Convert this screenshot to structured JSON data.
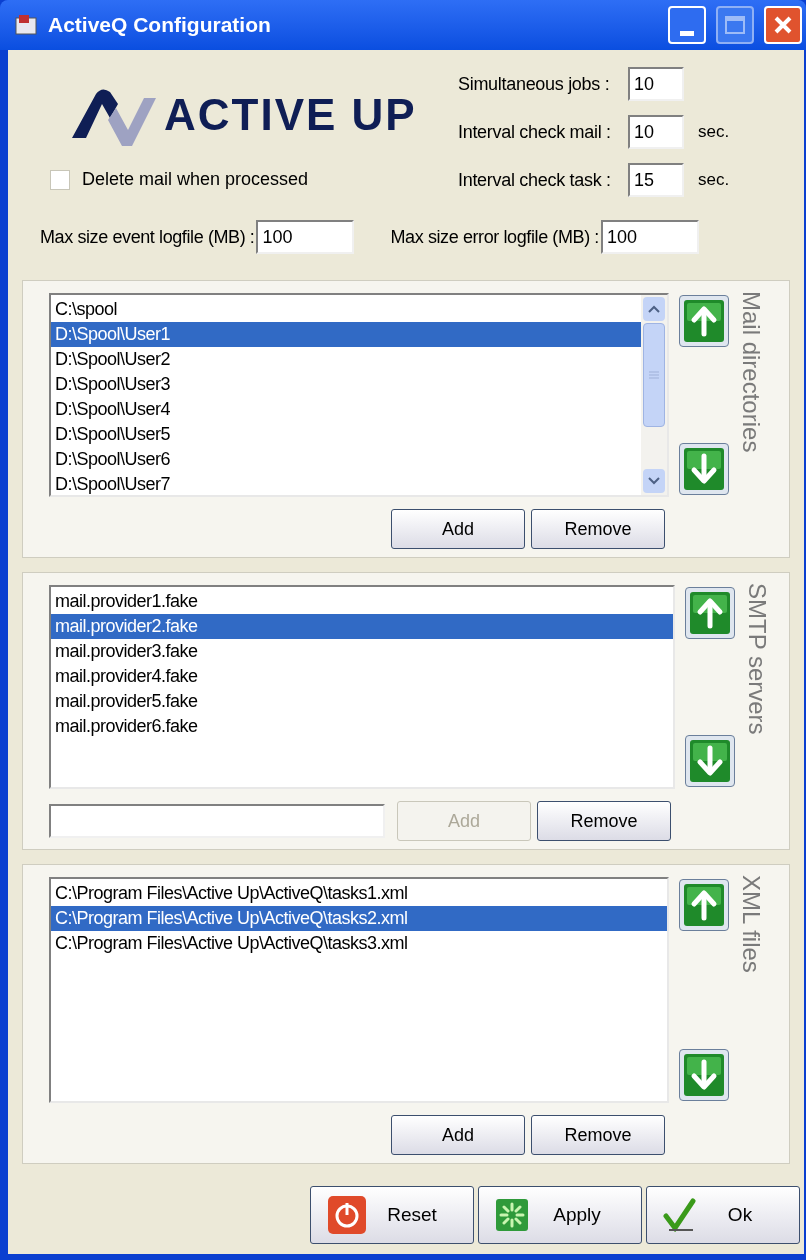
{
  "window": {
    "title": "ActiveQ Configuration"
  },
  "logo": {
    "text": "ACTIVE UP"
  },
  "settings": {
    "delete_mail": {
      "label": "Delete mail when processed",
      "checked": false
    },
    "fields": [
      {
        "label": "Simultaneous jobs :",
        "value": "10"
      },
      {
        "label": "Interval check mail :",
        "value": "10",
        "unit": "sec."
      },
      {
        "label": "Interval check task :",
        "value": "15",
        "unit": "sec."
      }
    ],
    "logfiles": [
      {
        "label": "Max size event logfile (MB) :",
        "value": "100"
      },
      {
        "label": "Max size error logfile (MB) :",
        "value": "100"
      }
    ]
  },
  "groups": [
    {
      "title": "Mail directories",
      "scrollbar": true,
      "input": false,
      "items": [
        {
          "label": "C:\\spool",
          "selected": false
        },
        {
          "label": "D:\\Spool\\User1",
          "selected": true
        },
        {
          "label": "D:\\Spool\\User2",
          "selected": false
        },
        {
          "label": "D:\\Spool\\User3",
          "selected": false
        },
        {
          "label": "D:\\Spool\\User4",
          "selected": false
        },
        {
          "label": "D:\\Spool\\User5",
          "selected": false
        },
        {
          "label": "D:\\Spool\\User6",
          "selected": false
        },
        {
          "label": "D:\\Spool\\User7",
          "selected": false
        }
      ],
      "buttons": [
        {
          "label": "Add",
          "disabled": false
        },
        {
          "label": "Remove",
          "disabled": false
        }
      ]
    },
    {
      "title": "SMTP servers",
      "scrollbar": false,
      "input": true,
      "items": [
        {
          "label": "mail.provider1.fake",
          "selected": false
        },
        {
          "label": "mail.provider2.fake",
          "selected": true
        },
        {
          "label": "mail.provider3.fake",
          "selected": false
        },
        {
          "label": "mail.provider4.fake",
          "selected": false
        },
        {
          "label": "mail.provider5.fake",
          "selected": false
        },
        {
          "label": "mail.provider6.fake",
          "selected": false
        }
      ],
      "buttons": [
        {
          "label": "Add",
          "disabled": true
        },
        {
          "label": "Remove",
          "disabled": false
        }
      ]
    },
    {
      "title": "XML files",
      "scrollbar": false,
      "input": false,
      "items": [
        {
          "label": "C:\\Program Files\\Active Up\\ActiveQ\\tasks1.xml",
          "selected": false
        },
        {
          "label": "C:\\Program Files\\Active Up\\ActiveQ\\tasks2.xml",
          "selected": true
        },
        {
          "label": "C:\\Program Files\\Active Up\\ActiveQ\\tasks3.xml",
          "selected": false
        }
      ],
      "buttons": [
        {
          "label": "Add",
          "disabled": false
        },
        {
          "label": "Remove",
          "disabled": false
        }
      ]
    }
  ],
  "footer": [
    {
      "kind": "reset",
      "label": "Reset"
    },
    {
      "kind": "apply",
      "label": "Apply"
    },
    {
      "kind": "ok",
      "label": "Ok"
    }
  ]
}
